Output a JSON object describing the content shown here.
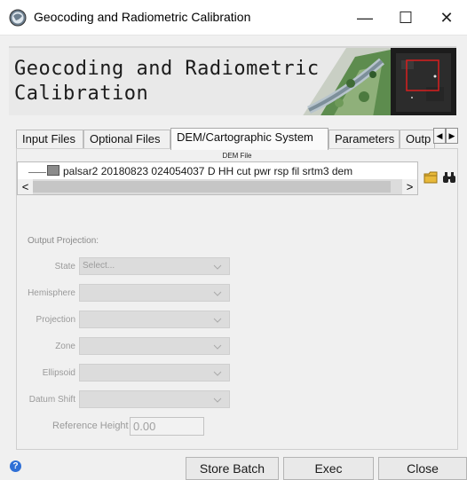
{
  "window": {
    "title": "Geocoding and Radiometric Calibration",
    "minimize_glyph": "—",
    "maximize_glyph": "☐",
    "close_glyph": "✕"
  },
  "banner": {
    "title": "Geocoding and Radiometric\nCalibration"
  },
  "tabs": [
    {
      "label": "Input Files",
      "active": false
    },
    {
      "label": "Optional Files",
      "active": false
    },
    {
      "label": "DEM/Cartographic System",
      "active": true
    },
    {
      "label": "Parameters",
      "active": false
    },
    {
      "label": "Outp",
      "active": false
    }
  ],
  "tab_scroll": {
    "left": "◀",
    "right": "▶"
  },
  "dem": {
    "label": "DEM File",
    "file": "palsar2 20180823 024054037 D HH cut pwr rsp fil srtm3 dem",
    "scroll_left": "<",
    "scroll_right": ">",
    "folder_icon": "open-folder-icon",
    "find_icon": "binoculars-icon"
  },
  "projection": {
    "section_title": "Output Projection:",
    "fields": [
      {
        "label": "State",
        "value": "Select..."
      },
      {
        "label": "Hemisphere",
        "value": ""
      },
      {
        "label": "Projection",
        "value": ""
      },
      {
        "label": "Zone",
        "value": ""
      },
      {
        "label": "Ellipsoid",
        "value": ""
      },
      {
        "label": "Datum Shift",
        "value": ""
      }
    ],
    "reference_height_label": "Reference Height",
    "reference_height_value": "0.00"
  },
  "footer": {
    "help": "?",
    "store_batch": "Store Batch",
    "exec": "Exec",
    "close": "Close"
  },
  "colors": {
    "accent": "#2f6fd6",
    "disabled_field": "#dcdcdc",
    "banner_bg": "#e9e9e9",
    "highlight_box": "#d81e1e"
  }
}
